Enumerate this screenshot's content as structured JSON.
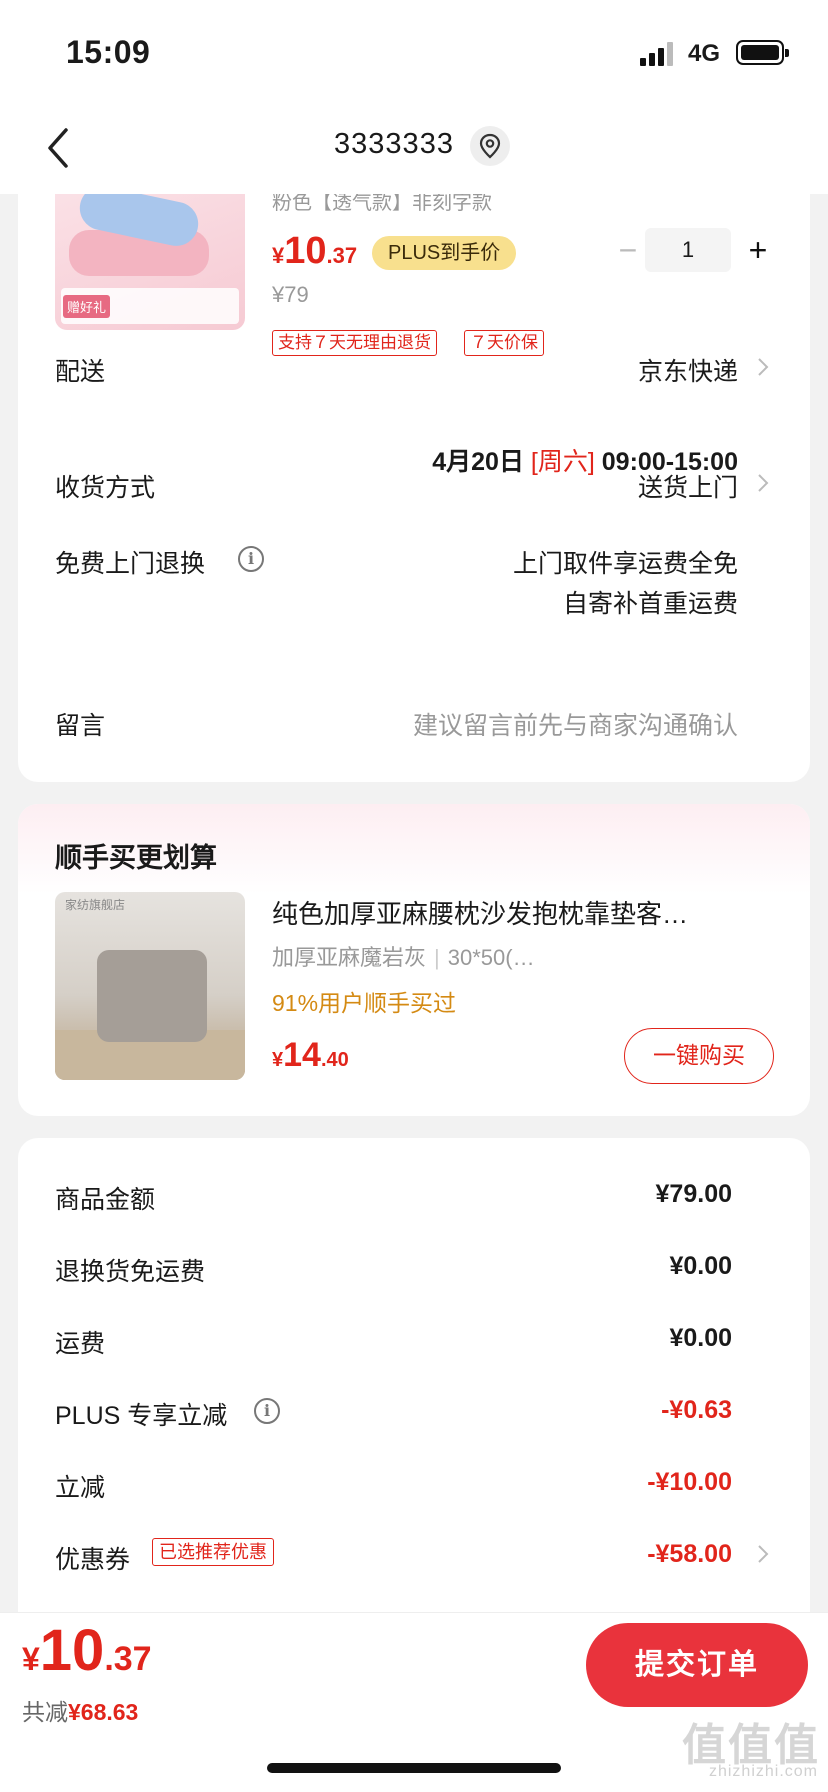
{
  "status_bar": {
    "time": "15:09",
    "network": "4G"
  },
  "nav": {
    "title": "3333333"
  },
  "product": {
    "subtitle": "粉色【透气款】非刻字款",
    "price_symbol": "¥",
    "price_int": "10",
    "price_dec": ".37",
    "plus_badge": "PLUS到手价",
    "original_price": "¥79",
    "quantity": "1",
    "minus": "−",
    "plus": "+",
    "tags": [
      "支持７天无理由退货",
      "７天价保"
    ]
  },
  "delivery": {
    "label": "配送",
    "carrier": "京东快递",
    "date": "4月20日",
    "weekday": "[周六]",
    "time_window": "09:00-15:00"
  },
  "receive": {
    "label": "收货方式",
    "value": "送货上门"
  },
  "free_return": {
    "label": "免费上门退换",
    "line1": "上门取件享运费全免",
    "line2": "自寄补首重运费"
  },
  "message": {
    "label": "留言",
    "placeholder": "建议留言前先与商家沟通确认"
  },
  "addon": {
    "title": "顺手买更划算",
    "name": "纯色加厚亚麻腰枕沙发抱枕靠垫客…",
    "spec1": "加厚亚麻魔岩灰",
    "spec2": "30*50(…",
    "buyers": "91%用户顺手买过",
    "price_symbol": "¥",
    "price_int": "14",
    "price_dec": ".40",
    "buy_label": "一键购买"
  },
  "fees": [
    {
      "label": "商品金额",
      "value": "¥79.00",
      "highlight": false
    },
    {
      "label": "退换货免运费",
      "value": "¥0.00",
      "highlight": false
    },
    {
      "label": "运费",
      "value": "¥0.00",
      "highlight": false
    },
    {
      "label": "PLUS 专享立减",
      "value": "-¥0.63",
      "highlight": true
    },
    {
      "label": "立减",
      "value": "-¥10.00",
      "highlight": true
    },
    {
      "label": "优惠券",
      "value": "-¥58.00",
      "highlight": true
    }
  ],
  "coupon_tag": "已选推荐优惠",
  "cut_text": "…………………………",
  "bottom": {
    "price_symbol": "¥",
    "price_int": "10",
    "price_dec": ".37",
    "saved_label": "共减",
    "saved_amount": "¥68.63",
    "submit": "提交订单"
  },
  "watermark": {
    "text": "值值值",
    "sub": "zhizhizhi.com"
  },
  "colors": {
    "accent": "#e1251b",
    "button": "#e9333c",
    "plus_badge": "#f8e08e",
    "buyers": "#d48a13"
  }
}
